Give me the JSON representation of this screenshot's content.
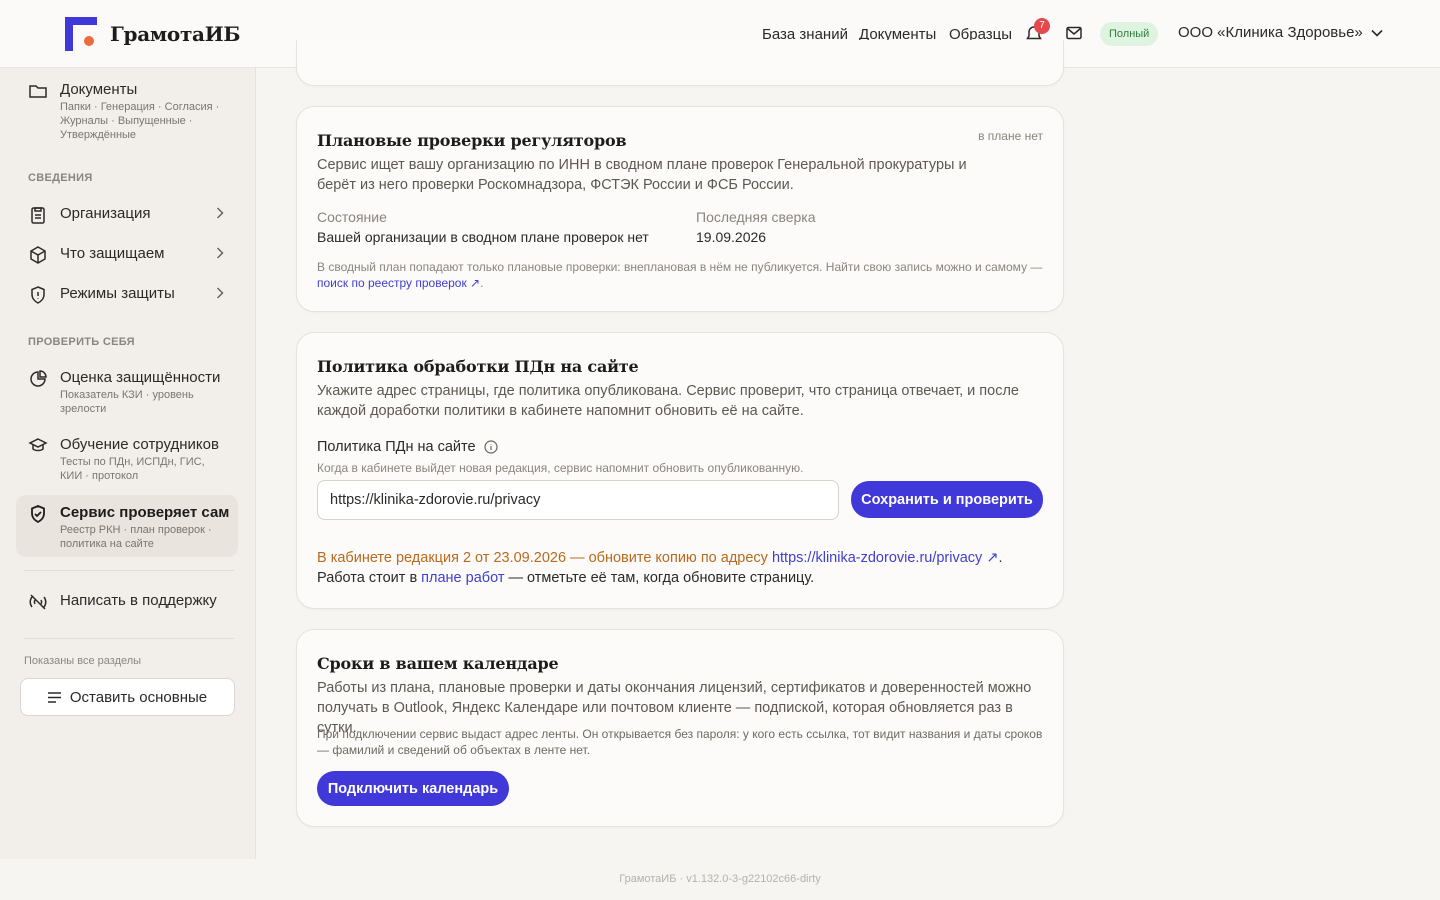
{
  "header": {
    "logo_text": "ГрамотаИБ",
    "nav": [
      "База знаний",
      "Документы",
      "Образцы"
    ],
    "notifications_count": "7",
    "plan_label": "Полный",
    "org_name": "ООО «Клиника Здоровье»"
  },
  "sidebar": {
    "documents": {
      "title": "Документы",
      "sub": "Папки · Генерация · Согласия · Журналы · Выпущенные · Утверждённые"
    },
    "section_info": "СВЕДЕНИЯ",
    "organization": "Организация",
    "what_protect": "Что защищаем",
    "protection_modes": "Режимы защиты",
    "section_check": "ПРОВЕРИТЬ СЕБЯ",
    "security_rating": {
      "title": "Оценка защищённости",
      "sub": "Показатель КЗИ · уровень зрелости"
    },
    "staff_training": {
      "title": "Обучение сотрудников",
      "sub": "Тесты по ПДн, ИСПДн, ГИС, КИИ · протокол"
    },
    "service_checks": {
      "title": "Сервис проверяет сам",
      "sub": "Реестр РКН · план проверок · политика на сайте"
    },
    "support": "Написать в поддержку",
    "shown_all": "Показаны все разделы",
    "keep_main_button": "Оставить основные"
  },
  "inspections": {
    "title": "Плановые проверки регуляторов",
    "status_tag": "в плане нет",
    "desc": "Сервис ищет вашу организацию по ИНН в сводном плане проверок Генеральной прокуратуры и берёт из него проверки Роскомнадзора, ФСТЭК России и ФСБ России.",
    "state_label": "Состояние",
    "state_value": "Вашей организации в сводном плане проверок нет",
    "last_check_label": "Последняя сверка",
    "last_check_value": "19.09.2026",
    "note_text": "В сводный план попадают только плановые проверки: внеплановая в нём не публикуется. Найти свою запись можно и самому —",
    "note_link": "поиск по реестру проверок ↗",
    "note_end": "."
  },
  "policy": {
    "title": "Политика обработки ПДн на сайте",
    "desc": "Укажите адрес страницы, где политика опубликована. Сервис проверит, что страница отвечает, и после каждой доработки политики в кабинете напомнит обновить её на сайте.",
    "field_label": "Политика ПДн на сайте",
    "field_hint": "Когда в кабинете выйдет новая редакция, сервис напомнит обновить опубликованную.",
    "field_value": "https://klinika-zdorovie.ru/privacy",
    "save_button": "Сохранить и проверить",
    "warning": "В кабинете редакция 2 от 23.09.2026 — обновите копию по адресу",
    "warning_link": "https://klinika-zdorovie.ru/privacy ↗",
    "warning_mid": ". Работа стоит в",
    "plan_link": "плане работ",
    "warning_end": "— отметьте её там, когда обновите страницу."
  },
  "calendar": {
    "title": "Сроки в вашем календаре",
    "desc": "Работы из плана, плановые проверки и даты окончания лицензий, сертификатов и доверенностей можно получать в Outlook, Яндекс Календаре или почтовом клиенте — подпиской, которая обновляется раз в сутки.",
    "note": "При подключении сервис выдаст адрес ленты. Он открывается без пароля: у кого есть ссылка, тот видит названия и даты сроков — фамилий и сведений об объектах в ленте нет.",
    "connect_button": "Подключить календарь"
  },
  "footer": {
    "version": "ГрамотаИБ · v1.132.0-3-g22102c66-dirty"
  },
  "colors": {
    "accent": "#4038d8",
    "warning": "#b86a1e",
    "link": "#3f3fd0",
    "success_bg": "#dff3e1",
    "badge": "#e5484d"
  }
}
